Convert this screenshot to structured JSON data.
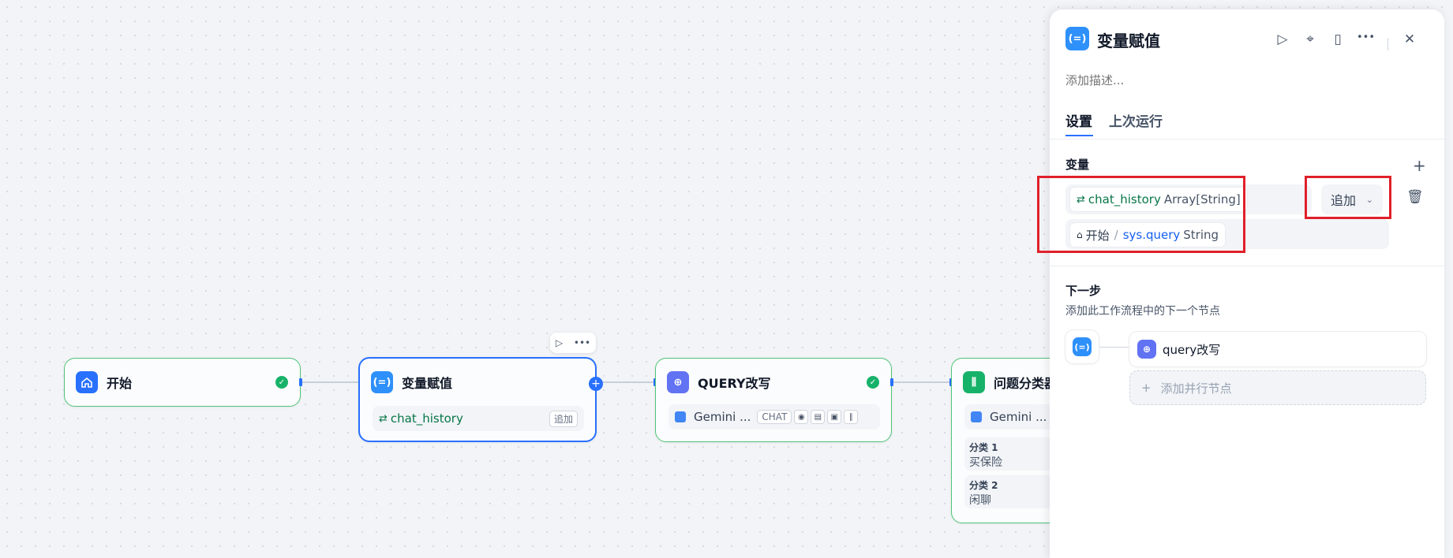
{
  "nodes": {
    "start": {
      "title": "开始"
    },
    "assign": {
      "title": "变量赋值",
      "var": "chat_history",
      "op": "追加"
    },
    "query": {
      "title": "QUERY改写",
      "model": "Gemini ...",
      "mode": "CHAT"
    },
    "classify": {
      "title": "问题分类器",
      "model": "Gemini ...",
      "classes": [
        {
          "label": "分类 1",
          "value": "买保险"
        },
        {
          "label": "分类 2",
          "value": "闲聊"
        }
      ]
    }
  },
  "panel": {
    "title": "变量赋值",
    "description_placeholder": "添加描述...",
    "tabs": [
      "设置",
      "上次运行"
    ],
    "variables_label": "变量",
    "assigned": {
      "name": "chat_history",
      "type": "Array[String]"
    },
    "source": {
      "node": "开始",
      "separator": "/",
      "name": "sys.query",
      "type": "String"
    },
    "operation": "追加",
    "next_step": {
      "title": "下一步",
      "desc": "添加此工作流程中的下一个节点",
      "next_node": "query改写",
      "add_parallel": "添加并行节点"
    }
  },
  "colors": {
    "accent": "#2970ff",
    "success": "#17b26a",
    "highlight": "#e0202a",
    "node_border": "#4fc477"
  }
}
